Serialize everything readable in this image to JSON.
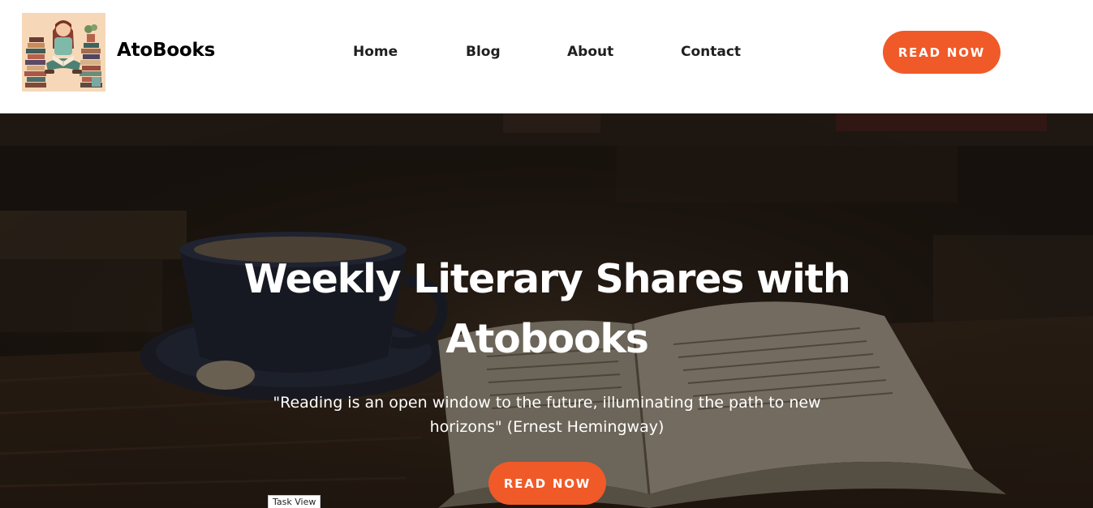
{
  "header": {
    "brand": "AtoBooks",
    "logo_icon": "girl-reading-books-icon",
    "nav": [
      {
        "label": "Home"
      },
      {
        "label": "Blog"
      },
      {
        "label": "About"
      },
      {
        "label": "Contact"
      }
    ],
    "cta_label": "READ NOW"
  },
  "hero": {
    "title_line1": "Weekly Literary Shares with",
    "title_line2": "Atobooks",
    "quote_line1": "\"Reading is an open window to the future, illuminating the path to new",
    "quote_line2": "horizons\" (Ernest Hemingway)",
    "cta_label": "READ NOW",
    "background_icon": "coffee-cup-and-open-book-icon"
  },
  "tooltip": {
    "text": "Task View"
  },
  "colors": {
    "accent": "#f05a28",
    "header_bg": "#ffffff",
    "hero_overlay": "#1a140f",
    "text_dark": "#1f1f1f"
  }
}
